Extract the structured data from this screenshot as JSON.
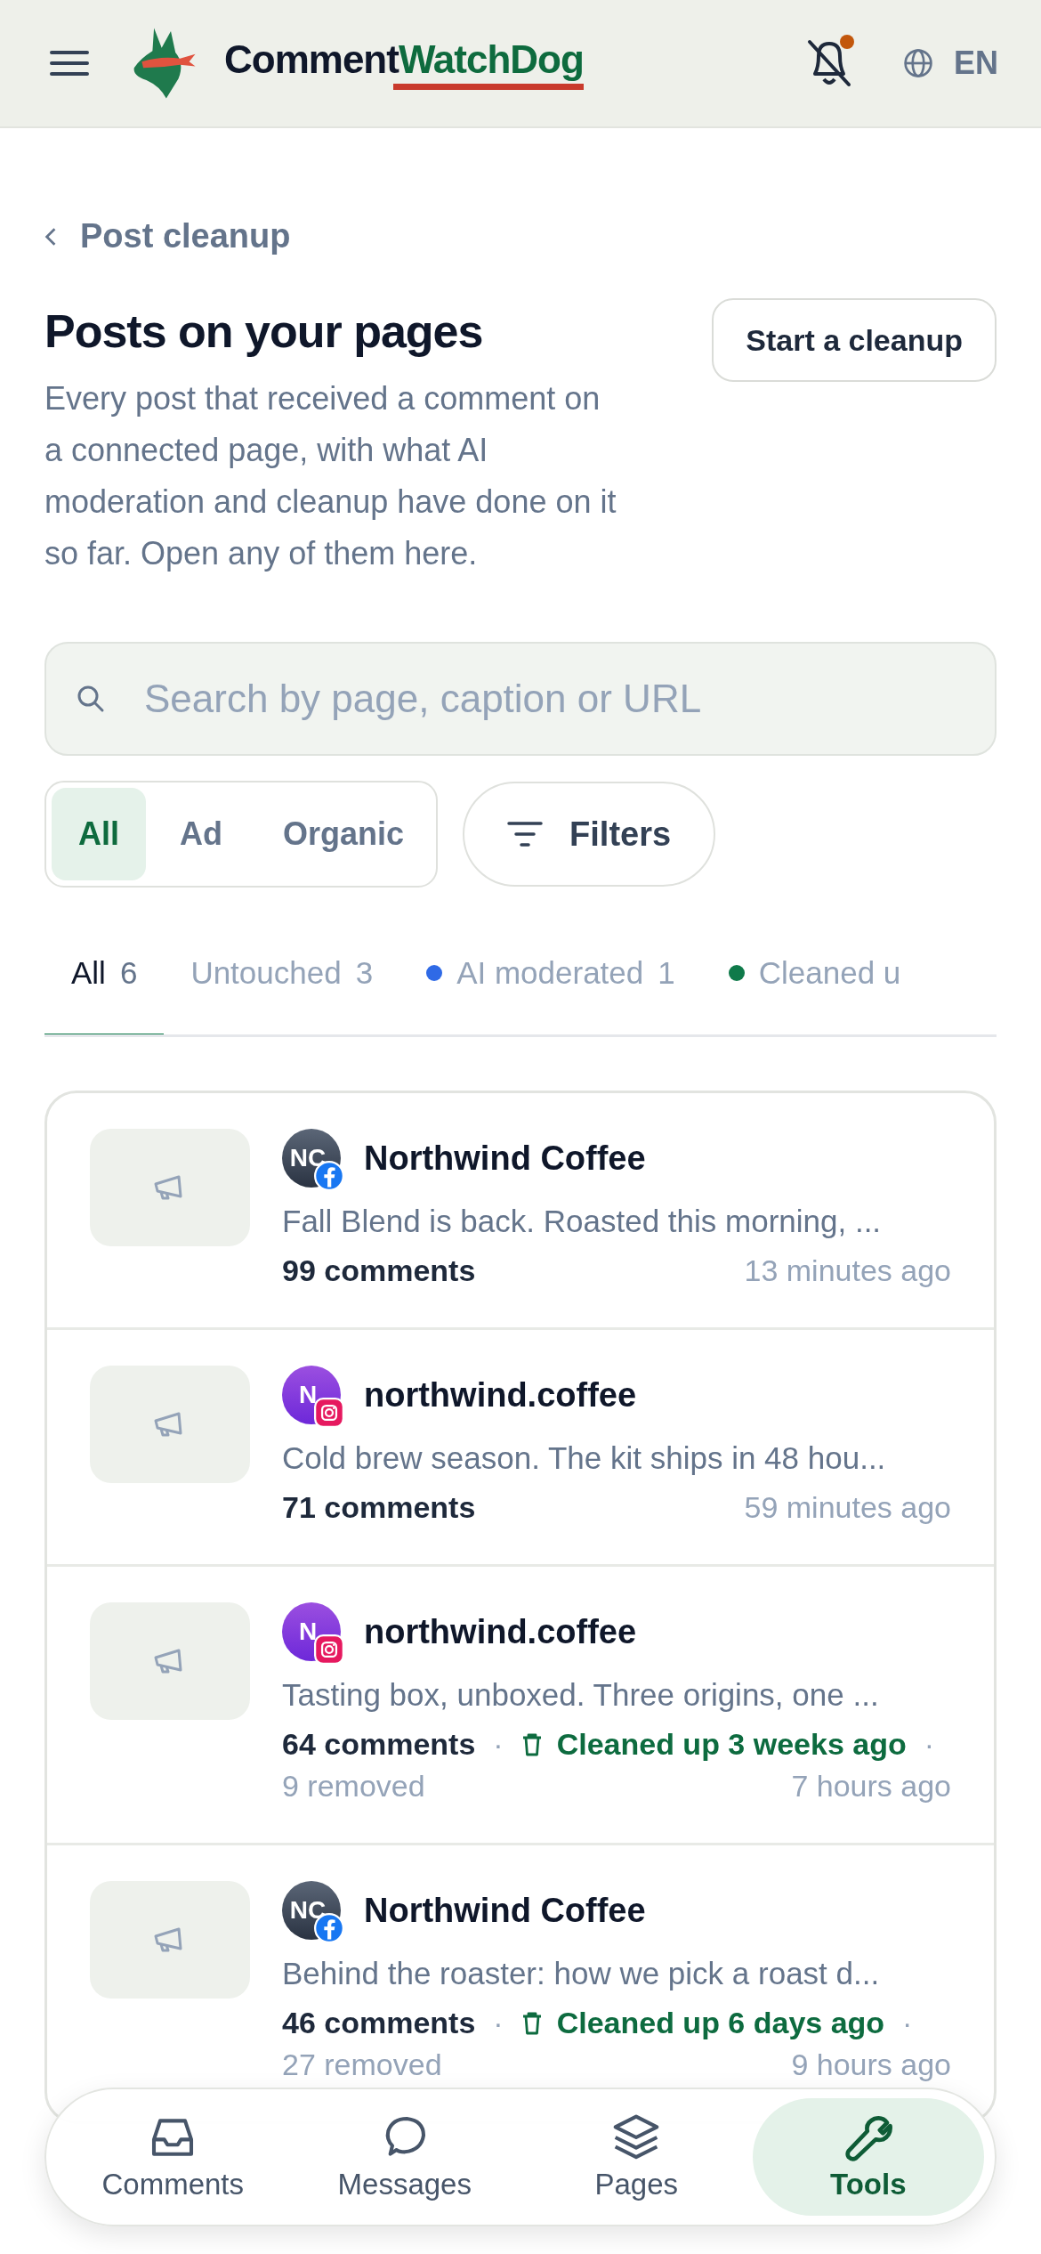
{
  "header": {
    "brand": [
      "Comment",
      "WatchDog"
    ],
    "notifications_unread": true,
    "language": "EN"
  },
  "breadcrumb": "Post cleanup",
  "title": "Posts on your pages",
  "description": "Every post that received a comment on a connected page, with what AI moderation and cleanup have done on it so far. Open any of them here.",
  "start_button": "Start a cleanup",
  "search": {
    "placeholder": "Search by page, caption or URL"
  },
  "segments": [
    {
      "label": "All",
      "selected": true
    },
    {
      "label": "Ad",
      "selected": false
    },
    {
      "label": "Organic",
      "selected": false
    }
  ],
  "filters_button": "Filters",
  "status_tabs": [
    {
      "label": "All",
      "count": "6",
      "selected": true
    },
    {
      "label": "Untouched",
      "count": "3",
      "selected": false
    },
    {
      "label": "AI moderated",
      "count": "1",
      "selected": false,
      "color": "#2f6ae6"
    },
    {
      "label": "Cleaned u",
      "selected": false,
      "color": "#0f7a4a"
    }
  ],
  "separator": "·",
  "posts": [
    {
      "page": "Northwind Coffee",
      "initials": "NC",
      "kind": "facebook",
      "caption": "Fall Blend is back. Roasted this morning, ...",
      "comments": "99 comments",
      "time": "13 minutes ago"
    },
    {
      "page": "northwind.coffee",
      "initials": "N",
      "kind": "instagram",
      "caption": "Cold brew season. The kit ships in 48 hou...",
      "comments": "71 comments",
      "time": "59 minutes ago"
    },
    {
      "page": "northwind.coffee",
      "initials": "N",
      "kind": "instagram",
      "caption": "Tasting box, unboxed. Three origins, one ...",
      "comments": "64 comments",
      "cleaned": "Cleaned up 3 weeks ago",
      "removed": "9 removed",
      "time": "7 hours ago"
    },
    {
      "page": "Northwind Coffee",
      "initials": "NC",
      "kind": "facebook",
      "caption": "Behind the roaster: how we pick a roast d...",
      "comments": "46 comments",
      "cleaned": "Cleaned up 6 days ago",
      "removed": "27 removed",
      "time": "9 hours ago"
    }
  ],
  "nav": [
    {
      "label": "Comments",
      "selected": false
    },
    {
      "label": "Messages",
      "selected": false
    },
    {
      "label": "Pages",
      "selected": false
    },
    {
      "label": "Tools",
      "selected": true
    }
  ]
}
